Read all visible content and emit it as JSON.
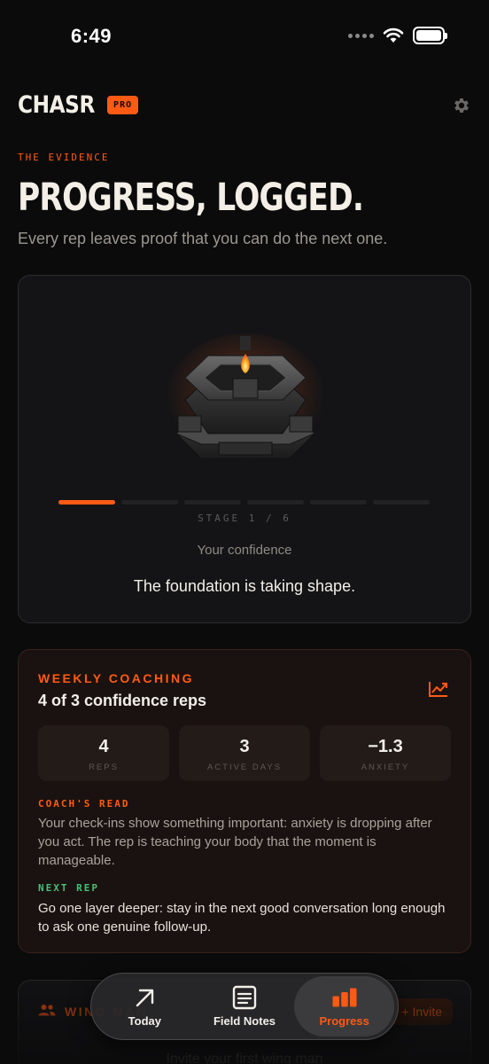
{
  "status_bar": {
    "time": "6:49"
  },
  "header": {
    "brand": "CHASR",
    "badge": "PRO"
  },
  "hero": {
    "eyebrow": "THE EVIDENCE",
    "title": "PROGRESS, LOGGED.",
    "subtitle": "Every rep leaves proof that you can do the next one."
  },
  "stage": {
    "label": "STAGE 1 / 6",
    "current": 1,
    "total": 6,
    "caption": "Your confidence",
    "message": "The foundation is taking shape."
  },
  "coaching": {
    "eyebrow": "WEEKLY COACHING",
    "title": "4 of 3 confidence reps",
    "stats": [
      {
        "value": "4",
        "label": "REPS"
      },
      {
        "value": "3",
        "label": "ACTIVE DAYS"
      },
      {
        "value": "−1.3",
        "label": "ANXIETY"
      }
    ],
    "coach_read_label": "COACH'S READ",
    "coach_read_text": "Your check-ins show something important: anxiety is dropping after you act. The rep is teaching your body that the moment is manageable.",
    "next_rep_label": "NEXT REP",
    "next_rep_text": "Go one layer deeper: stay in the next good conversation long enough to ask one genuine follow-up."
  },
  "wing_man": {
    "title": "WING MAN",
    "invite_label": "Invite",
    "empty_text": "Invite your first wing man"
  },
  "tabs": [
    {
      "label": "Today",
      "icon": "arrow-up-right-icon",
      "active": false
    },
    {
      "label": "Field Notes",
      "icon": "notes-icon",
      "active": false
    },
    {
      "label": "Progress",
      "icon": "bar-chart-icon",
      "active": true
    }
  ],
  "colors": {
    "accent": "#ff5a14",
    "success": "#46c078",
    "background": "#0b0b0c"
  }
}
